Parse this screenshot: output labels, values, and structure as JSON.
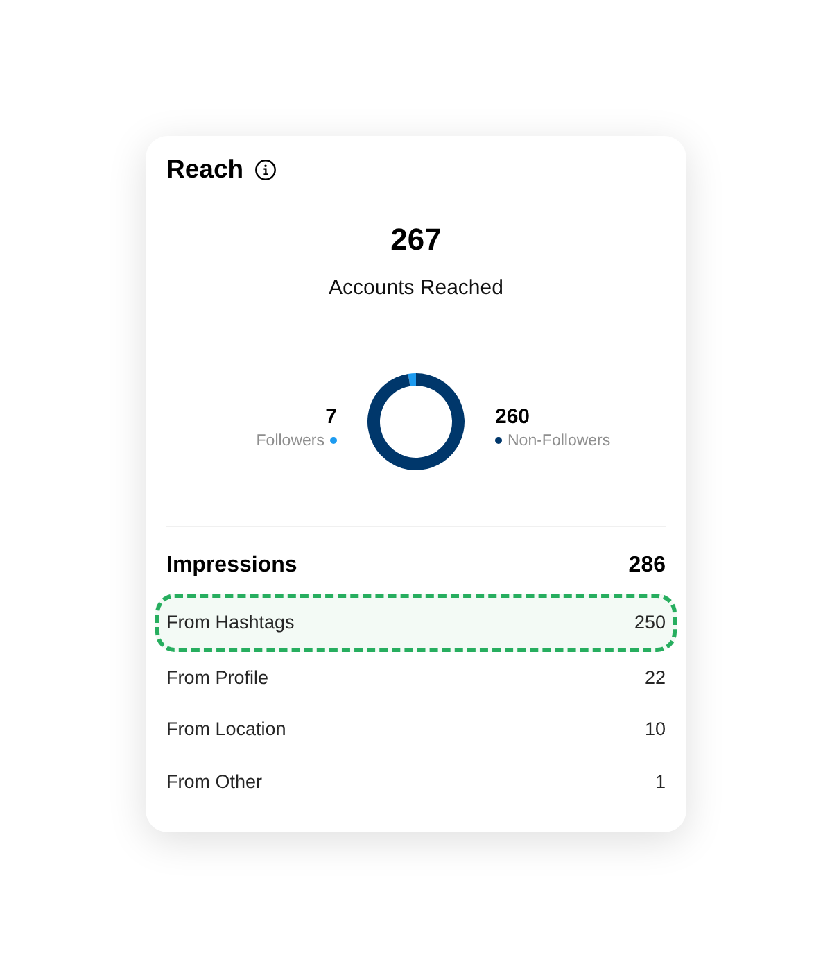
{
  "reach": {
    "title": "Reach",
    "summary": {
      "value": "267",
      "label": "Accounts Reached"
    },
    "chart_data": {
      "type": "donut",
      "categories": [
        "Followers",
        "Non-Followers"
      ],
      "values": [
        2.62,
        97.38
      ]
    },
    "legend": [
      {
        "value": "7",
        "color": "#1d9bf0"
      },
      {
        "value": "260",
        "color": "#00376b"
      }
    ]
  },
  "impressions": {
    "title": "Impressions",
    "total": "286",
    "rows": [
      {
        "label": "From Hashtags",
        "value": "250",
        "highlighted": true
      },
      {
        "label": "From Profile",
        "value": "22",
        "highlighted": false
      },
      {
        "label": "From Location",
        "value": "10",
        "highlighted": false
      },
      {
        "label": "From Other",
        "value": "1",
        "highlighted": false
      }
    ]
  }
}
